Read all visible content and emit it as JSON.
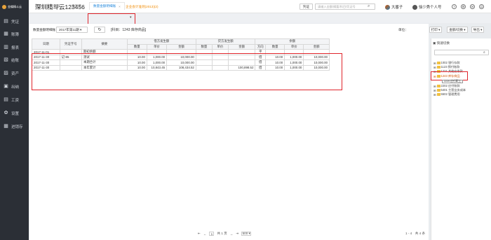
{
  "app": {
    "logo_text": "金蝶精斗云"
  },
  "sidebar": {
    "items": [
      {
        "label": "凭证",
        "icon": "voucher-icon",
        "glyph": "▤"
      },
      {
        "label": "账簿",
        "icon": "ledger-icon",
        "glyph": "▦"
      },
      {
        "label": "报表",
        "icon": "report-icon",
        "glyph": "▥"
      },
      {
        "label": "结账",
        "icon": "checkout-icon",
        "glyph": "▧"
      },
      {
        "label": "资产",
        "icon": "asset-icon",
        "glyph": "▨"
      },
      {
        "label": "出纳",
        "icon": "cashier-icon",
        "glyph": "▣"
      },
      {
        "label": "工资",
        "icon": "salary-icon",
        "glyph": "▤"
      },
      {
        "label": "设置",
        "icon": "gear-icon",
        "glyph": "✿"
      },
      {
        "label": "进销存",
        "icon": "inventory-icon",
        "glyph": "▦"
      }
    ]
  },
  "header": {
    "company": "深圳精斗云123456",
    "period": "2017年第11期 ▾",
    "notice": "● 企业会计准则(2013)(2)",
    "search_type": "凭证",
    "search_placeholder": "请输入金额/摘要/科目/凭证号",
    "user_name": "大番子",
    "personal_label": "徐少秀个人号"
  },
  "tabs": [
    {
      "label": "首页"
    },
    {
      "label": "科目"
    },
    {
      "label": "查凭证"
    },
    {
      "label": "数量金额明细账",
      "close": "×"
    }
  ],
  "tab_dropdown": "▾",
  "toolbar": {
    "label": "数量金额明细账",
    "period": "2017年第11期 ▾",
    "refresh": "↻",
    "subject": "[科目：1243 库存商品]",
    "unit_label": "单位：",
    "print": "打印 ▾",
    "toggle_format": "金额/切换 ▾",
    "export": "导出 ▾"
  },
  "table": {
    "headers_top": [
      "日期",
      "凭证字号",
      "摘要",
      "借方发生额",
      "贷方发生额",
      "余额"
    ],
    "headers_sub": [
      "数量",
      "单价",
      "金额",
      "数量",
      "单价",
      "金额",
      "方向",
      "数量",
      "单价",
      "金额"
    ],
    "rows": [
      [
        "2017-11-01",
        "",
        "期初余额",
        "",
        "",
        "",
        "",
        "",
        "",
        "平",
        "",
        "",
        ""
      ],
      [
        "2017-11-30",
        "记-85",
        "测试",
        "10.00",
        "1,000.00",
        "10,000.00",
        "",
        "",
        "",
        "借",
        "10.00",
        "1,000.00",
        "10,000.00"
      ],
      [
        "2017-11-30",
        "",
        "本期合计",
        "10.00",
        "1,000.00",
        "10,000.00",
        "",
        "",
        "",
        "借",
        "10.00",
        "1,000.00",
        "10,000.00"
      ],
      [
        "2017-11-30",
        "",
        "本年累计",
        "10.00",
        "10,843.45",
        "108,434.52",
        "",
        "",
        "100,898.52",
        "借",
        "10.00",
        "1,000.00",
        "10,000.00"
      ]
    ]
  },
  "pager": {
    "first": "⇤",
    "prev": "←",
    "page_input": "1",
    "of_pages": "共 1 页",
    "next": "→",
    "last": "⇥",
    "page_size": "500 ▾",
    "record_count": "1 - 4　共 4 条"
  },
  "quick_filter": {
    "title": "▣ 快速切换",
    "tree": [
      {
        "label": "1002 银行存款",
        "expander": "⊞"
      },
      {
        "label": "1123 预付账款",
        "expander": "⊞"
      },
      {
        "label": "1221 其他应收款",
        "expander": "⊞"
      },
      {
        "label": "1243 库存商品",
        "expander": "⊞"
      },
      {
        "label": "2202 应付账款",
        "expander": "⊞"
      },
      {
        "label": "5401 主营业务成本",
        "expander": "⊞"
      },
      {
        "label": "5502 管理费用",
        "expander": "⊞"
      }
    ],
    "tooltip": "2220 应付职工"
  },
  "colors": {
    "accent": "#2c8dde",
    "highlight": "#e0242b",
    "sidebar_bg": "#2b2f36"
  }
}
